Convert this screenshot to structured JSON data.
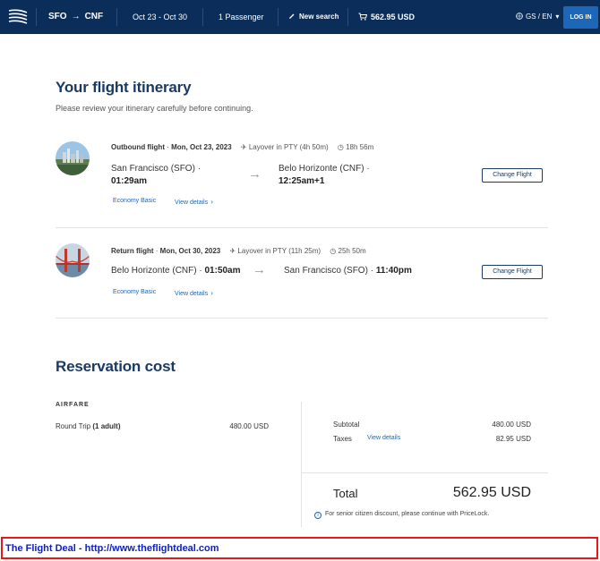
{
  "header": {
    "origin": "SFO",
    "destination": "CNF",
    "route_arrow": "→",
    "dates": "Oct 23 - Oct 30",
    "passengers": "1 Passenger",
    "new_search": "New search",
    "cart_total": "562.95 USD",
    "locale": "GS / EN",
    "login": "LOG IN"
  },
  "itinerary": {
    "title": "Your flight itinerary",
    "subtitle": "Please review your itinerary carefully before continuing.",
    "outbound": {
      "label": "Outbound flight",
      "date": "Mon, Oct 23, 2023",
      "layover": "Layover in PTY (4h 50m)",
      "duration": "18h 56m",
      "from_city": "San Francisco (SFO) ·",
      "from_time": "01:29am",
      "to_city": "Belo Horizonte (CNF) ·",
      "to_time": "12:25am+1",
      "fare": "Economy Basic",
      "details": "View details",
      "change": "Change Flight"
    },
    "return": {
      "label": "Return flight",
      "date": "Mon, Oct 30, 2023",
      "layover": "Layover in PTY (11h 25m)",
      "duration": "25h 50m",
      "from_city": "Belo Horizonte (CNF) ·",
      "from_time": "01:50am",
      "to_city": "San Francisco (SFO) ·",
      "to_time": "11:40pm",
      "fare": "Economy Basic",
      "details": "View details",
      "change": "Change Flight"
    }
  },
  "cost": {
    "title": "Reservation cost",
    "airfare_label": "AIRFARE",
    "trip_label": "Round Trip",
    "trip_adult": "(1 adult)",
    "trip_price": "480.00 USD",
    "subtotal_label": "Subtotal",
    "subtotal_value": "480.00 USD",
    "taxes_label": "Taxes",
    "taxes_link": "View details",
    "taxes_value": "82.95 USD",
    "total_label": "Total",
    "total_value": "562.95 USD",
    "note": "For senior citizen discount, please continue with PriceLock."
  },
  "banner": {
    "text": "The Flight Deal - http://www.theflightdeal.com"
  },
  "colors": {
    "header_bg": "#0b2d59",
    "accent": "#1d67b8",
    "heading": "#1b3a63",
    "banner_border": "#e8171c",
    "banner_text": "#0d1fc4"
  }
}
